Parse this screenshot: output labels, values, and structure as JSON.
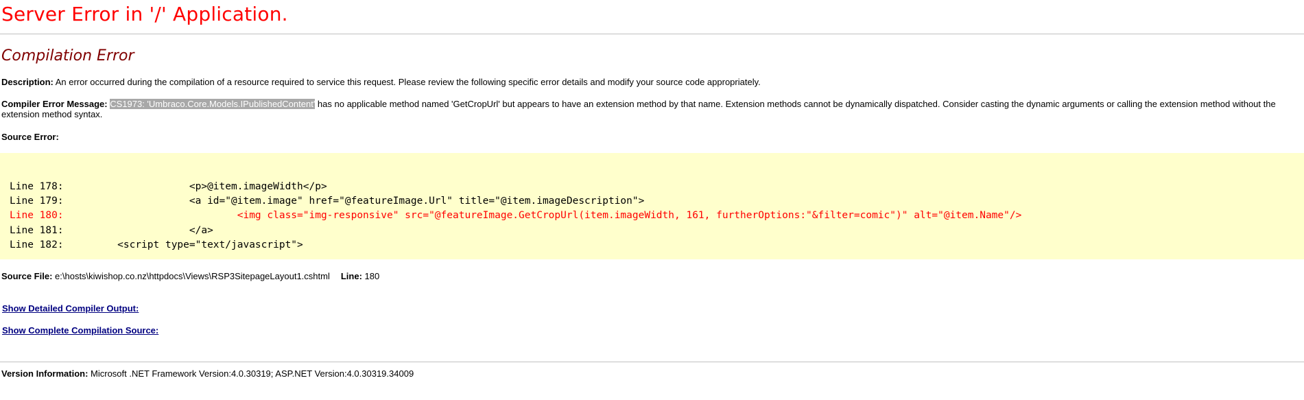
{
  "page": {
    "title": "Server Error in '/' Application.",
    "subtitle": "Compilation Error"
  },
  "description": {
    "label": "Description:",
    "text": " An error occurred during the compilation of a resource required to service this request. Please review the following specific error details and modify your source code appropriately."
  },
  "compiler_message": {
    "label": "Compiler Error Message:",
    "highlighted": "CS1973: 'Umbraco.Core.Models.IPublishedContent'",
    "text": " has no applicable method named 'GetCropUrl' but appears to have an extension method by that name. Extension methods cannot be dynamically dispatched. Consider casting the dynamic arguments or calling the extension method without the extension method syntax."
  },
  "source_error": {
    "label": "Source Error:",
    "lines": [
      {
        "text": "Line 178:                     <p>@item.imageWidth</p>",
        "error": false
      },
      {
        "text": "Line 179:                     <a id=\"@item.image\" href=\"@featureImage.Url\" title=\"@item.imageDescription\">",
        "error": false
      },
      {
        "text": "Line 180:                             <img class=\"img-responsive\" src=\"@featureImage.GetCropUrl(item.imageWidth, 161, furtherOptions:\"&filter=comic\")\" alt=\"@item.Name\"/>",
        "error": true
      },
      {
        "text": "Line 181:                     </a>",
        "error": false
      },
      {
        "text": "Line 182:         <script type=\"text/javascript\">",
        "error": false
      }
    ]
  },
  "source_file": {
    "label": "Source File:",
    "path": " e:\\hosts\\kiwishop.co.nz\\httpdocs\\Views\\RSP3SitepageLayout1.cshtml",
    "line_label": "Line:",
    "line_value": " 180"
  },
  "links": {
    "detailed_output": "Show Detailed Compiler Output:",
    "complete_source": "Show Complete Compilation Source:"
  },
  "version": {
    "label": "Version Information:",
    "text": " Microsoft .NET Framework Version:4.0.30319; ASP.NET Version:4.0.30319.34009"
  },
  "colors": {
    "title": "#ff0000",
    "subtitle": "#800000",
    "code_background": "#ffffcc",
    "error_line": "#ff0000",
    "link": "#000080",
    "highlight_background": "#a8a8a8"
  }
}
